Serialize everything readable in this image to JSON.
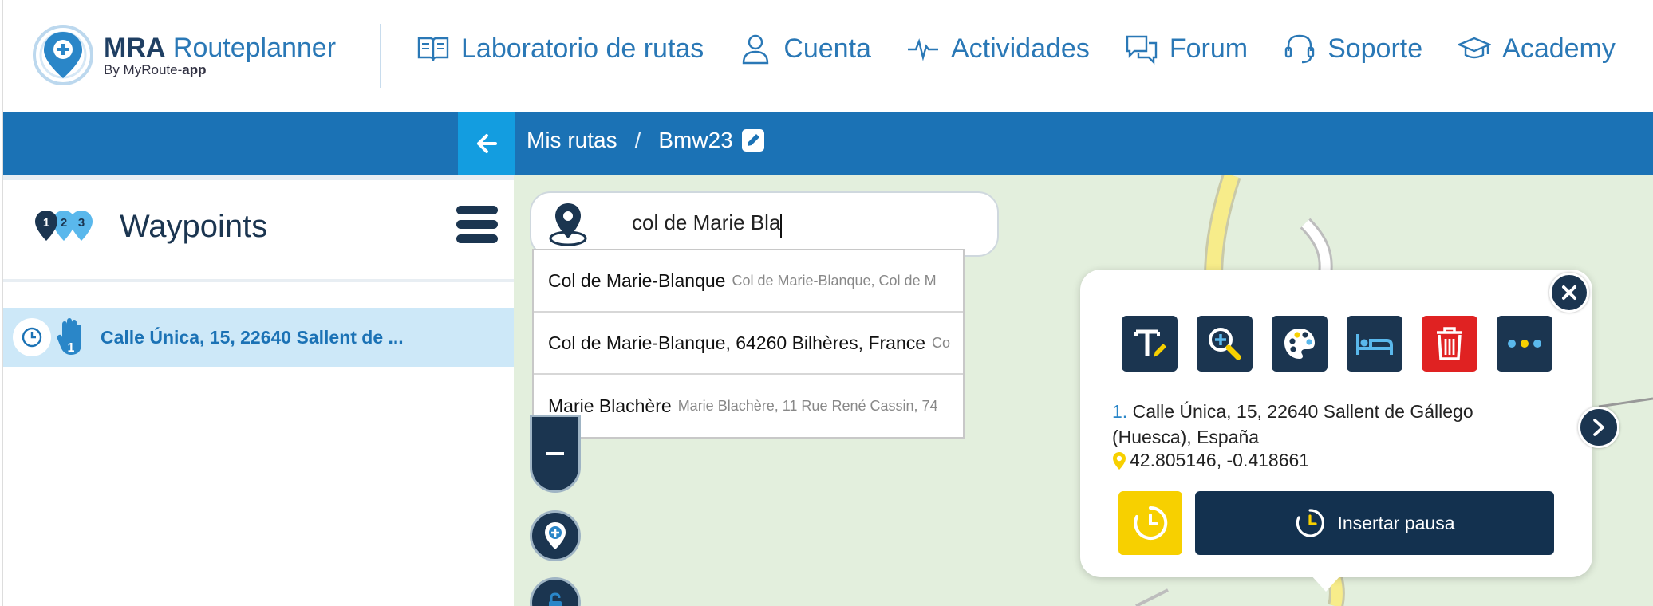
{
  "app": {
    "logo_title_bold": "MRA",
    "logo_title": " Routeplanner",
    "logo_sub": "By MyRoute-",
    "logo_sub_bold": "app"
  },
  "nav": {
    "items": [
      {
        "label": "Laboratorio de rutas",
        "icon": "book-icon"
      },
      {
        "label": "Cuenta",
        "icon": "user-icon"
      },
      {
        "label": "Actividades",
        "icon": "activity-icon"
      },
      {
        "label": "Forum",
        "icon": "chat-icon"
      },
      {
        "label": "Soporte",
        "icon": "headset-icon"
      },
      {
        "label": "Academy",
        "icon": "graduation-cap-icon"
      }
    ]
  },
  "breadcrumb": {
    "parent": "Mis rutas",
    "separator": "/",
    "current": "Bmw23"
  },
  "sidebar": {
    "title": "Waypoints",
    "badges": [
      "1",
      "2",
      "3"
    ],
    "waypoint": {
      "number": "1",
      "label": "Calle Única, 15, 22640 Sallent de ..."
    }
  },
  "search": {
    "value": "col de Marie Bla",
    "results": [
      {
        "main": "Col de Marie-Blanque",
        "sub": "Col de Marie-Blanque, Col de M"
      },
      {
        "main": "Col de Marie-Blanque, 64260 Bilhères, France",
        "sub": "Co"
      },
      {
        "main": "Marie Blachère",
        "sub": "Marie Blachère, 11 Rue René Cassin, 74"
      }
    ]
  },
  "popup": {
    "number": "1.",
    "address": "Calle Única, 15, 22640 Sallent de Gállego (Huesca), España",
    "coords": "42.805146, -0.418661",
    "insert_pause": "Insertar pausa"
  },
  "colors": {
    "brand_blue": "#1b72b5",
    "navy": "#1b3550",
    "accent_cyan": "#139de0",
    "delete_red": "#e02222",
    "pause_yellow": "#f7d000",
    "map_green": "#e3efdd"
  }
}
